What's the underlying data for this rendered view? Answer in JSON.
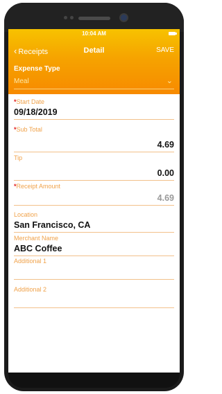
{
  "status": {
    "time": "10:04 AM"
  },
  "nav": {
    "back_label": "Receipts",
    "title": "Detail",
    "save_label": "SAVE"
  },
  "expense_type": {
    "label": "Expense Type",
    "value": "Meal"
  },
  "fields": [
    {
      "label": "Start Date",
      "required": true,
      "value": "09/18/2019"
    },
    {
      "label": "Sub Total",
      "required": true,
      "value": "4.69"
    },
    {
      "label": "Tip",
      "required": false,
      "value": "0.00"
    },
    {
      "label": "Receipt Amount",
      "required": true,
      "value": "4.69"
    },
    {
      "label": "Location",
      "required": false,
      "value": "San Francisco, CA"
    },
    {
      "label": "Merchant Name",
      "required": false,
      "value": "ABC Coffee"
    },
    {
      "label": "Additional 1",
      "required": false,
      "value": ""
    },
    {
      "label": "Additional 2",
      "required": false,
      "value": ""
    }
  ],
  "colors": {
    "accent": "#f6a300",
    "label": "#f0a24a",
    "required": "#e21b1b"
  }
}
